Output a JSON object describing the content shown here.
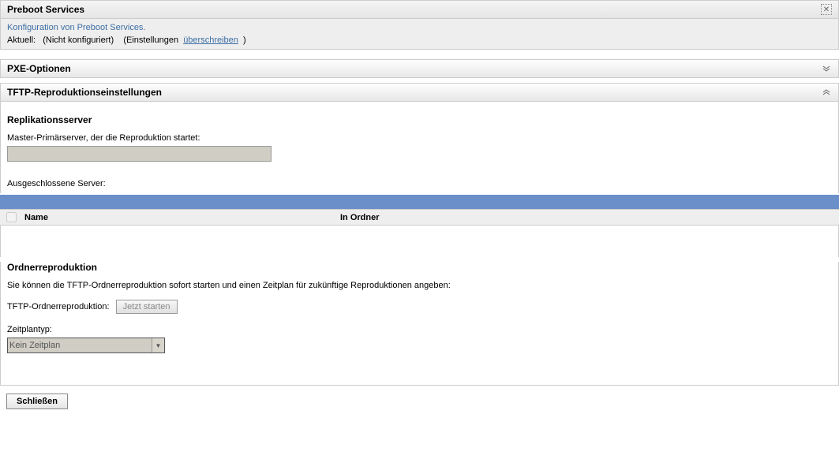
{
  "header": {
    "title": "Preboot Services",
    "subtitle": "Konfiguration von Preboot Services.",
    "status_label": "Aktuell:",
    "status_value": "(Nicht konfiguriert)",
    "settings_prefix": "(Einstellungen",
    "override_link": "überschreiben",
    "settings_suffix": ")"
  },
  "sections": {
    "pxe": {
      "title": "PXE-Optionen"
    },
    "tftp": {
      "title": "TFTP-Reproduktionseinstellungen"
    }
  },
  "replication": {
    "heading": "Replikationsserver",
    "master_label": "Master-Primärserver, der die Reproduktion startet:",
    "master_value": "",
    "excluded_label": "Ausgeschlossene Server:"
  },
  "table": {
    "col_name": "Name",
    "col_folder": "In Ordner"
  },
  "folder_reproduction": {
    "heading": "Ordnerreproduktion",
    "description": "Sie können die TFTP-Ordnerreproduktion sofort starten und einen Zeitplan für zukünftige Reproduktionen angeben:",
    "label": "TFTP-Ordnerreproduktion:",
    "start_button": "Jetzt starten",
    "schedule_label": "Zeitplantyp:",
    "schedule_value": "Kein Zeitplan"
  },
  "footer": {
    "close_button": "Schließen"
  }
}
